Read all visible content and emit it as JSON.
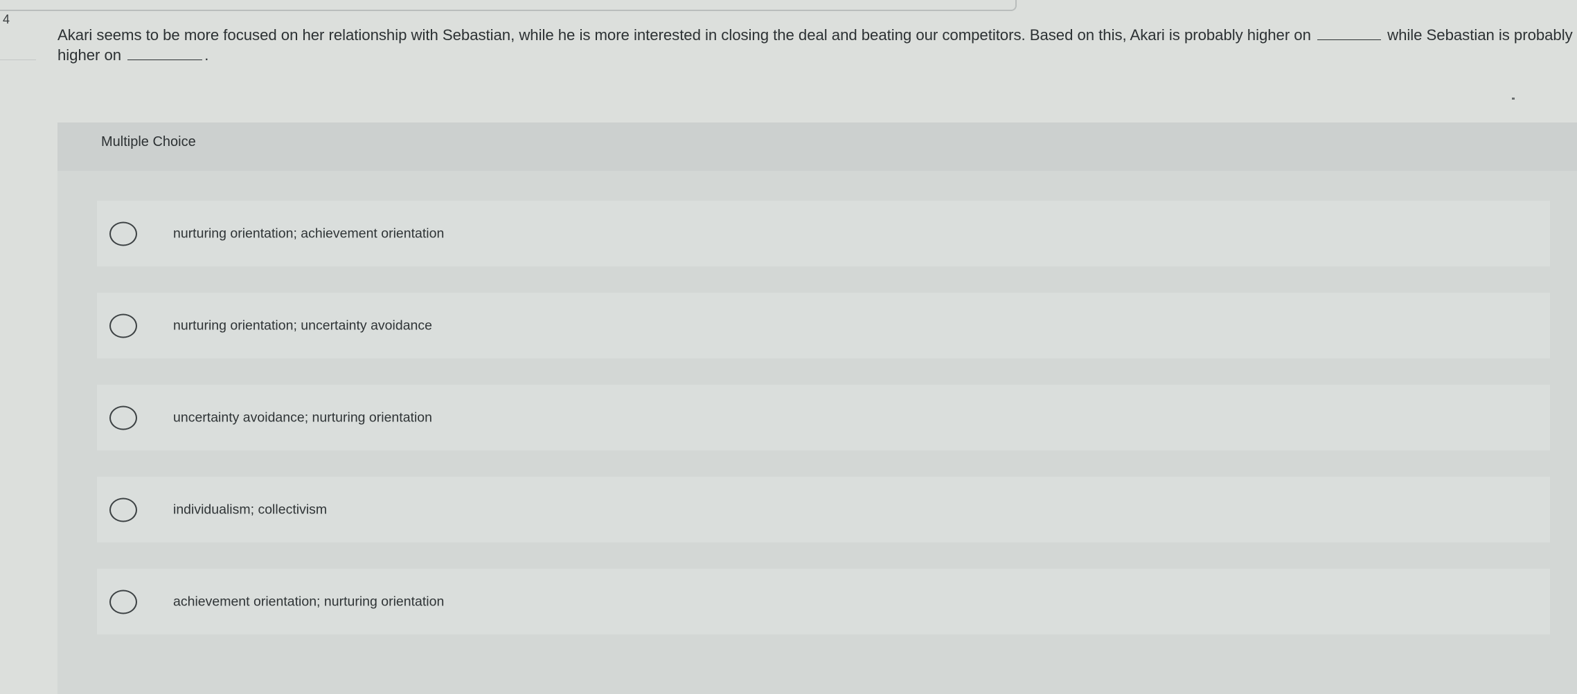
{
  "question": {
    "number": "4",
    "text_part1": "Akari seems to be more focused on her relationship with Sebastian, while he is more interested in closing the deal and beating our competitors. Based on this, Akari is probably higher on",
    "text_part2": "while Sebastian is probably higher on",
    "text_end": "."
  },
  "multiple_choice": {
    "header": "Multiple Choice",
    "options": [
      {
        "label": "nurturing orientation; achievement orientation",
        "selected": false
      },
      {
        "label": "nurturing orientation; uncertainty avoidance",
        "selected": false
      },
      {
        "label": "uncertainty avoidance; nurturing orientation",
        "selected": false
      },
      {
        "label": "individualism; collectivism",
        "selected": false
      },
      {
        "label": "achievement orientation; nurturing orientation",
        "selected": false
      }
    ]
  }
}
